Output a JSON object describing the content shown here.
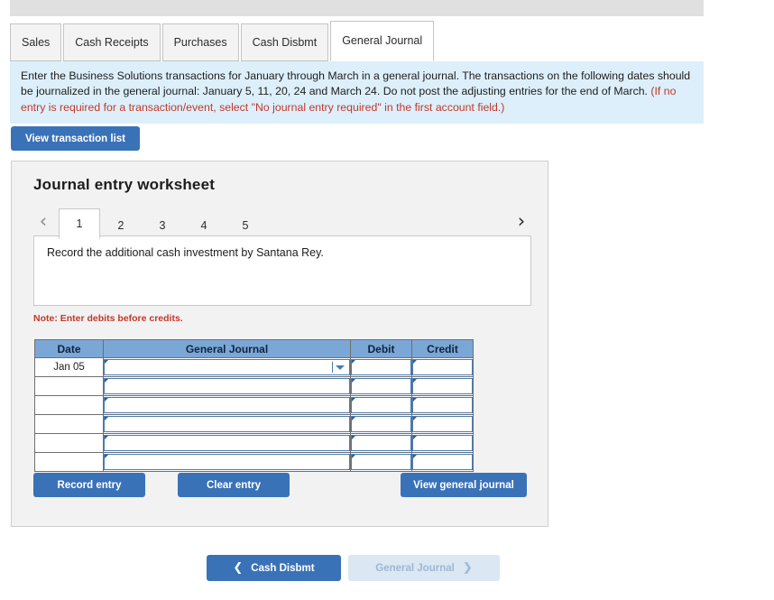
{
  "tabs": [
    {
      "label": "Sales",
      "active": false
    },
    {
      "label": "Cash Receipts",
      "active": false
    },
    {
      "label": "Purchases",
      "active": false
    },
    {
      "label": "Cash Disbmt",
      "active": false
    },
    {
      "label": "General Journal",
      "active": true
    }
  ],
  "instructions": {
    "black_text": "Enter the Business Solutions transactions for January through March in a general journal. The transactions on the following dates should be journalized in the general journal: January 5, 11, 20, 24 and March 24. Do not post the adjusting entries for the end of March. ",
    "red_text": "(If no entry is required for a transaction/event, select \"No journal entry required\" in the first account field.)"
  },
  "transaction_list_button": "View transaction list",
  "worksheet": {
    "title": "Journal entry worksheet",
    "pager": {
      "prev_icon": "chevron-left-icon",
      "next_icon": "chevron-right-icon",
      "pages": [
        "1",
        "2",
        "3",
        "4",
        "5"
      ],
      "active_page": "1"
    },
    "description": "Record the additional cash investment by Santana Rey.",
    "note": "Note: Enter debits before credits.",
    "table": {
      "headers": [
        "Date",
        "General Journal",
        "Debit",
        "Credit"
      ],
      "rows": [
        {
          "date": "Jan 05",
          "account": "",
          "debit": "",
          "credit": "",
          "has_dropdown": true
        },
        {
          "date": "",
          "account": "",
          "debit": "",
          "credit": "",
          "has_dropdown": false
        },
        {
          "date": "",
          "account": "",
          "debit": "",
          "credit": "",
          "has_dropdown": false
        },
        {
          "date": "",
          "account": "",
          "debit": "",
          "credit": "",
          "has_dropdown": false
        },
        {
          "date": "",
          "account": "",
          "debit": "",
          "credit": "",
          "has_dropdown": false
        },
        {
          "date": "",
          "account": "",
          "debit": "",
          "credit": "",
          "has_dropdown": false
        }
      ]
    },
    "buttons": {
      "record": "Record entry",
      "clear": "Clear entry",
      "view_journal": "View general journal"
    }
  },
  "bottom_nav": {
    "prev_label": "Cash Disbmt",
    "prev_icon": "chevron-left-icon",
    "next_label": "General Journal",
    "next_icon": "chevron-right-icon",
    "next_disabled": true
  },
  "colors": {
    "primary_blue": "#3a72b8",
    "table_header_blue": "#7ba7d7",
    "instruction_bg": "#ddeffa",
    "alert_red": "#c0392b",
    "panel_gray": "#f2f2f2"
  }
}
